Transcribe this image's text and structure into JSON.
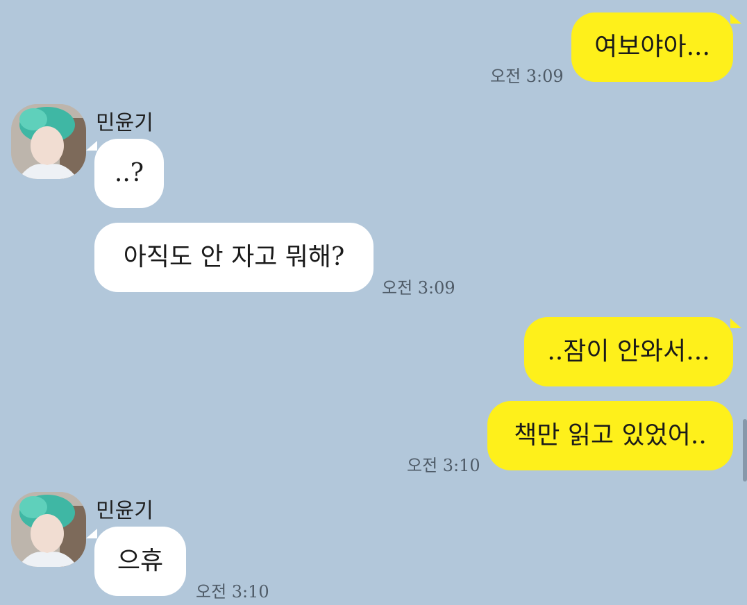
{
  "contact": {
    "name": "민윤기"
  },
  "messages": [
    {
      "sender": "me",
      "text": "여보야아...",
      "time": "오전 3:09"
    },
    {
      "sender": "contact",
      "text": "..?",
      "time": ""
    },
    {
      "sender": "contact",
      "text": "아직도 안 자고 뭐해?",
      "time": "오전 3:09"
    },
    {
      "sender": "me",
      "text": "..잠이 안와서...",
      "time": ""
    },
    {
      "sender": "me",
      "text": "책만 읽고 있었어..",
      "time": "오전 3:10"
    },
    {
      "sender": "contact",
      "text": "으휴",
      "time": "오전 3:10"
    }
  ],
  "colors": {
    "background": "#b2c7da",
    "my_bubble": "#fef01b",
    "their_bubble": "#ffffff"
  }
}
